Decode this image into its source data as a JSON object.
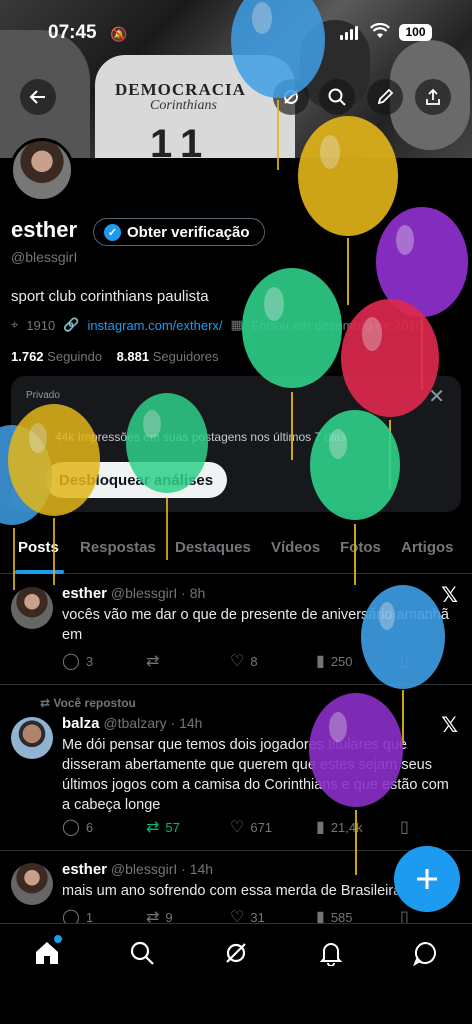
{
  "status_bar": {
    "time": "07:45",
    "battery": "100"
  },
  "profile": {
    "name": "esther",
    "verify_label": "Obter verificação",
    "handle": "@blessgirI",
    "bio": "sport club corinthians paulista",
    "location": "1910",
    "link": "instagram.com/extherx/",
    "joined": "Entrou em dezembro de 2016",
    "following_count": "1.762",
    "following_label": "Seguindo",
    "followers_count": "8.881",
    "followers_label": "Seguidores"
  },
  "banner": {
    "shirt_text": "DEMOCRACIA",
    "shirt_script": "Corinthians",
    "shirt_number": "11"
  },
  "analytics": {
    "private_label": "Privado",
    "impressions_text": "44k Impressões em suas postagens nos últimos 7 dias",
    "unlock_label": "Desbloquear análises"
  },
  "tabs": [
    {
      "label": "Posts"
    },
    {
      "label": "Respostas"
    },
    {
      "label": "Destaques"
    },
    {
      "label": "Vídeos"
    },
    {
      "label": "Fotos"
    },
    {
      "label": "Artigos"
    }
  ],
  "posts": [
    {
      "name": "esther",
      "handle": "@blessgirI",
      "time": "· 8h",
      "text": "vocês vão me dar o que de presente de aniversário amanhã em",
      "replies": "3",
      "reposts": "",
      "likes": "8",
      "views": "250"
    },
    {
      "repost_label": "Você repostou",
      "name": "balza",
      "handle": "@tbalzary",
      "time": "· 14h",
      "text": "Me dói pensar que temos dois jogadores titulares que disseram abertamente que querem que estes sejam seus últimos jogos com a camisa do Corinthians e que estão com a cabeça longe",
      "replies": "6",
      "reposts": "57",
      "likes": "671",
      "views": "21,4k"
    },
    {
      "name": "esther",
      "handle": "@blessgirI",
      "time": "· 14h",
      "text": "mais um ano sofrendo com essa merda de Brasileirão",
      "replies": "1",
      "reposts": "9",
      "likes": "31",
      "views": "585"
    }
  ],
  "colors": {
    "accent": "#1d9bf0",
    "repost_green": "#00ba7c",
    "background": "#000000"
  },
  "balloon_colors": [
    "#3f9fe6",
    "#e3b619",
    "#8b2fc9",
    "#2fd08a",
    "#e0294e",
    "#2fd08a",
    "#e3b619",
    "#2fd08a",
    "#3f9fe6",
    "#8b2fc9"
  ]
}
